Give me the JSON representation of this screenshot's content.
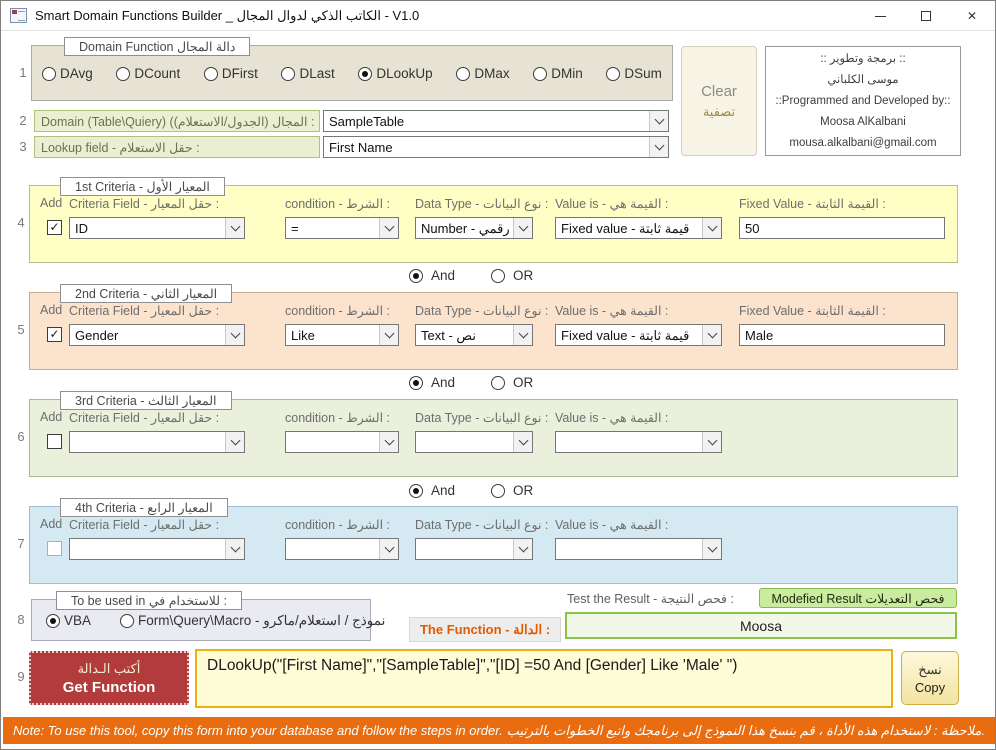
{
  "title_bar": {
    "title": "Smart Domain Functions Builder _ الكاتب الذكي لدوال المجال   -   V1.0",
    "close_glyph": "✕"
  },
  "step1": {
    "number": "1",
    "group_label": "Domain Function   دالة المجال",
    "options": [
      {
        "label": "DAvg",
        "selected": false
      },
      {
        "label": "DCount",
        "selected": false
      },
      {
        "label": "DFirst",
        "selected": false
      },
      {
        "label": "DLast",
        "selected": false
      },
      {
        "label": "DLookUp",
        "selected": true
      },
      {
        "label": "DMax",
        "selected": false
      },
      {
        "label": "DMin",
        "selected": false
      },
      {
        "label": "DSum",
        "selected": false
      }
    ]
  },
  "clear_button": {
    "line1": "Clear",
    "line2": "تصفية"
  },
  "credits": {
    "line1": ":: برمجة وتطوير ::",
    "line2": "موسى الكلباني",
    "line3": "::Programmed and Developed by::",
    "line4": "Moosa AlKalbani",
    "line5": "mousa.alkalbani@gmail.com"
  },
  "step2": {
    "number": "2",
    "label": "Domain (Table\\Quiery) (المجال (الجدول/الاستعلام) :",
    "value": "SampleTable"
  },
  "step3": {
    "number": "3",
    "label": "Lookup field  -  حقل الاستعلام :",
    "value": "First Name"
  },
  "criteria": [
    {
      "number": "4",
      "tab": "1st Criteria - المعيار الأول",
      "add_label": "Add",
      "check": "✓",
      "field_label": "Criteria Field - حقل المعيار :",
      "field": "ID",
      "condition_label": "condition - الشرط :",
      "condition": "=",
      "datatype_label": "Data Type - نوع البيانات :",
      "datatype": "Number - رقمي",
      "value_label": "Value is - القيمة هي :",
      "value": "Fixed value - قيمة ثابتة",
      "fixed_label": "Fixed Value  - القيمة الثابتة :",
      "fixed": "50"
    },
    {
      "number": "5",
      "tab": "2nd Criteria - المعيار الثاني",
      "add_label": "Add",
      "check": "✓",
      "field_label": "Criteria Field - حقل المعيار :",
      "field": "Gender",
      "condition_label": "condition - الشرط :",
      "condition": "Like",
      "datatype_label": "Data Type - نوع البيانات :",
      "datatype": "Text - نص",
      "value_label": "Value is - القيمة هي :",
      "value": "Fixed value - قيمة ثابتة",
      "fixed_label": "Fixed Value  - القيمة الثابتة :",
      "fixed": "Male"
    },
    {
      "number": "6",
      "tab": "3rd Criteria - المعيار الثالث",
      "add_label": "Add",
      "check": "",
      "field_label": "Criteria Field - حقل المعيار :",
      "field": "",
      "condition_label": "condition - الشرط :",
      "condition": "",
      "datatype_label": "Data Type - نوع البيانات :",
      "datatype": "",
      "value_label": "Value is - القيمة هي :",
      "value": ""
    },
    {
      "number": "7",
      "tab": "4th Criteria - المعيار الرابع",
      "add_label": "Add",
      "check": "",
      "field_label": "Criteria Field - حقل المعيار :",
      "field": "",
      "condition_label": "condition - الشرط :",
      "condition": "",
      "datatype_label": "Data Type - نوع البيانات :",
      "datatype": "",
      "value_label": "Value is - القيمة هي :",
      "value": ""
    }
  ],
  "operators": {
    "and_label": "And",
    "or_label": "OR"
  },
  "step8": {
    "number": "8",
    "group_label": "To be used in   للاستخدام في :",
    "options": [
      {
        "label": "VBA",
        "selected": true
      },
      {
        "label": "Form\\Query\\Macro - نموذج / استعلام/ماكرو",
        "selected": false
      }
    ]
  },
  "function_section": {
    "function_label": "The Function - الدالة :",
    "test_label": "Test the Result - فحص النتيجة :",
    "modified_button": "Modefied Result   فحص التعديلات",
    "result_value": "Moosa"
  },
  "step9": {
    "number": "9",
    "get_button_ar": "أكتب الـدالة",
    "get_button_en": "Get Function",
    "function_text": "DLookUp(\"[First Name]\",\"[SampleTable]\",\"[ID] =50 And [Gender] Like 'Male' \")",
    "copy_ar": "نسخ",
    "copy_en": "Copy"
  },
  "note": {
    "en": "Note: To use this tool, copy this form into your database and follow the steps in order.",
    "ar": "ملاحظة : لاستخدام هذه الأداة ، قم بنسخ هذا النموذج إلى برنامجك واتبع الخطوات بالترتيب."
  },
  "colors": {
    "note_bar": "#E96D10",
    "get_button": "#B23B3B",
    "function_box_border": "#EFB111",
    "result_border": "#8BC34A",
    "modified_button_bg": "#C9EC9E",
    "criteria1_bg": "#FFFFC5",
    "criteria2_bg": "#FBE3CD",
    "criteria3_bg": "#EAF0DC",
    "criteria4_bg": "#D5E9F2"
  }
}
